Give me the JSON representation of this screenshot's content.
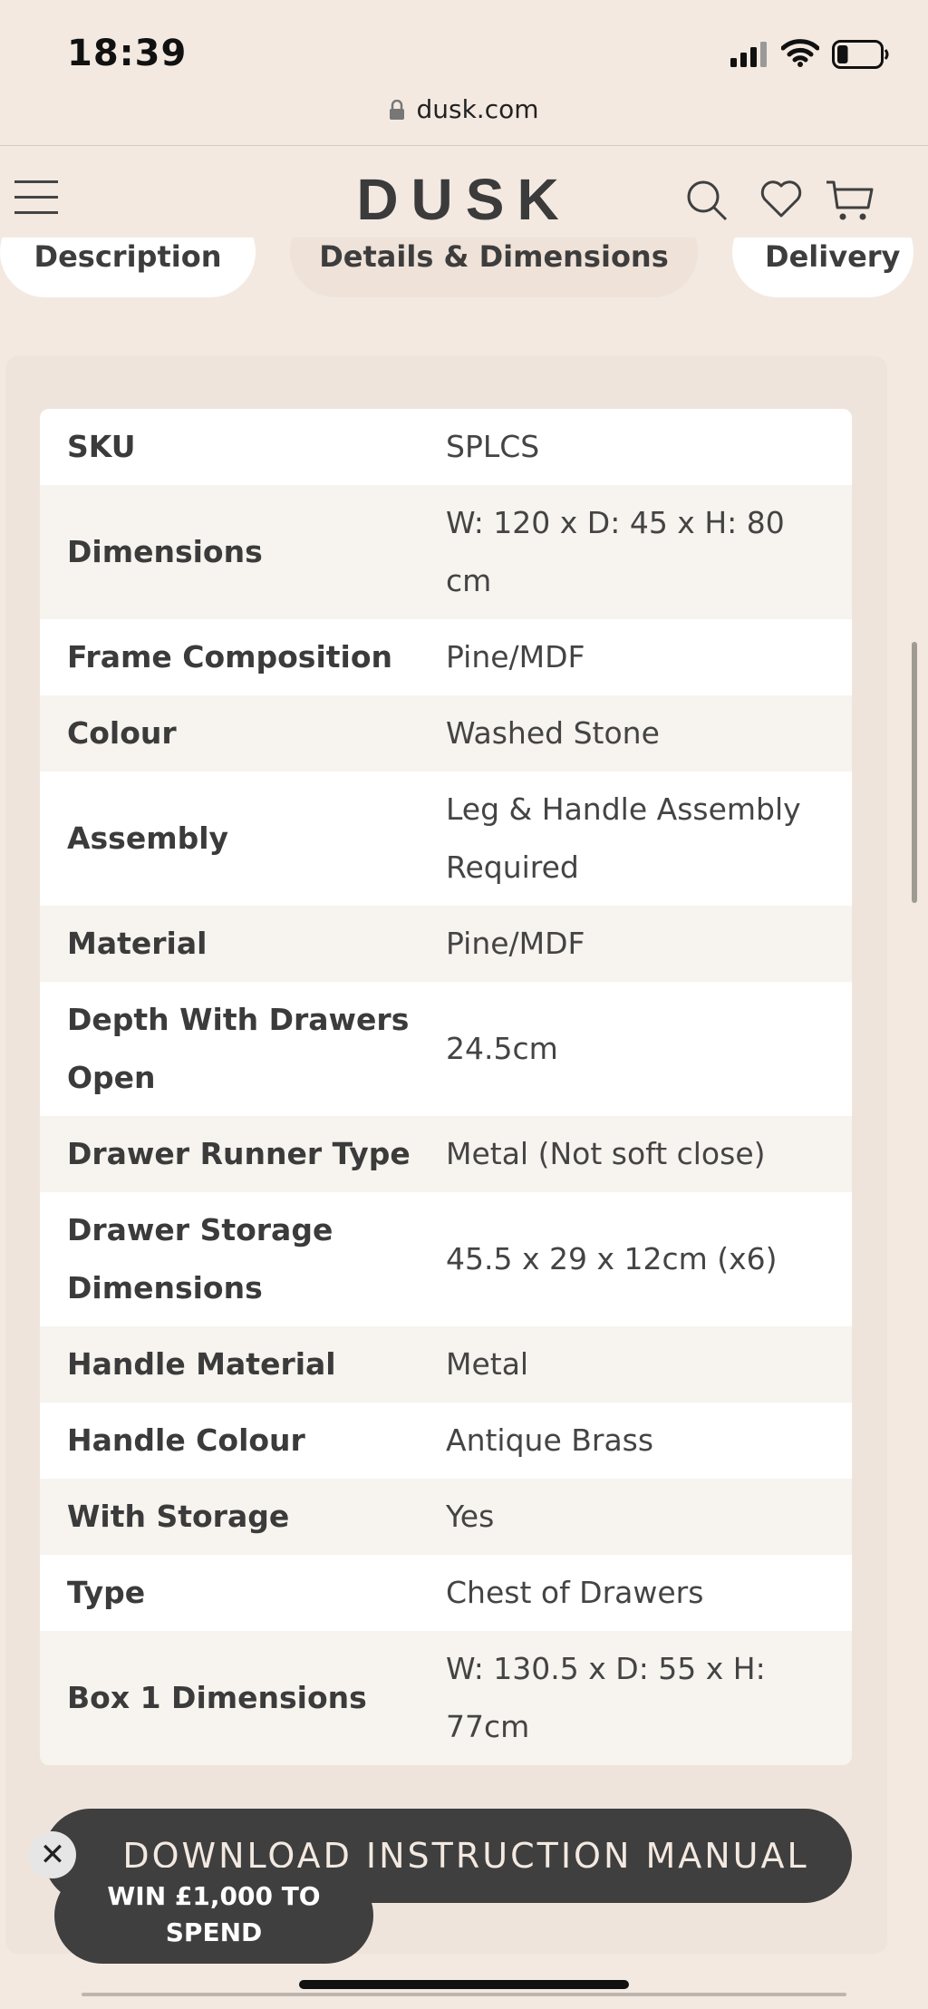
{
  "status_bar": {
    "time": "18:39",
    "battery_level": 0.25
  },
  "browser": {
    "url": "dusk.com"
  },
  "header": {
    "logo": "DUSK"
  },
  "tabs": [
    {
      "label": "Description",
      "active": false
    },
    {
      "label": "Details & Dimensions",
      "active": true
    },
    {
      "label": "Delivery",
      "active": false
    }
  ],
  "details": [
    {
      "label": "SKU",
      "value": "SPLCS"
    },
    {
      "label": "Dimensions",
      "value": "W: 120 x D: 45 x H: 80 cm"
    },
    {
      "label": "Frame Composition",
      "value": "Pine/MDF"
    },
    {
      "label": "Colour",
      "value": "Washed Stone"
    },
    {
      "label": "Assembly",
      "value": "Leg & Handle Assembly Required"
    },
    {
      "label": "Material",
      "value": "Pine/MDF"
    },
    {
      "label": "Depth With Drawers Open",
      "value": "24.5cm"
    },
    {
      "label": "Drawer Runner Type",
      "value": "Metal (Not soft close)"
    },
    {
      "label": "Drawer Storage Dimensions",
      "value": "45.5 x 29 x 12cm (x6)"
    },
    {
      "label": "Handle Material",
      "value": "Metal"
    },
    {
      "label": "Handle Colour",
      "value": "Antique Brass"
    },
    {
      "label": "With Storage",
      "value": "Yes"
    },
    {
      "label": "Type",
      "value": "Chest of Drawers"
    },
    {
      "label": "Box 1 Dimensions",
      "value": "W: 130.5 x D: 55 x H: 77cm"
    }
  ],
  "download_button": {
    "label": "DOWNLOAD INSTRUCTION MANUAL"
  },
  "promo": {
    "line1": "WIN £1,000 TO",
    "line2": "SPEND",
    "close_symbol": "✕"
  },
  "colors": {
    "background": "#f3e9e1",
    "dark_button": "#3f3f3f",
    "active_tab": "#efe2d8"
  },
  "icons": [
    "lock-icon",
    "menu-icon",
    "search-icon",
    "heart-icon",
    "cart-icon",
    "close-icon",
    "signal-icon",
    "wifi-icon",
    "battery-icon"
  ]
}
